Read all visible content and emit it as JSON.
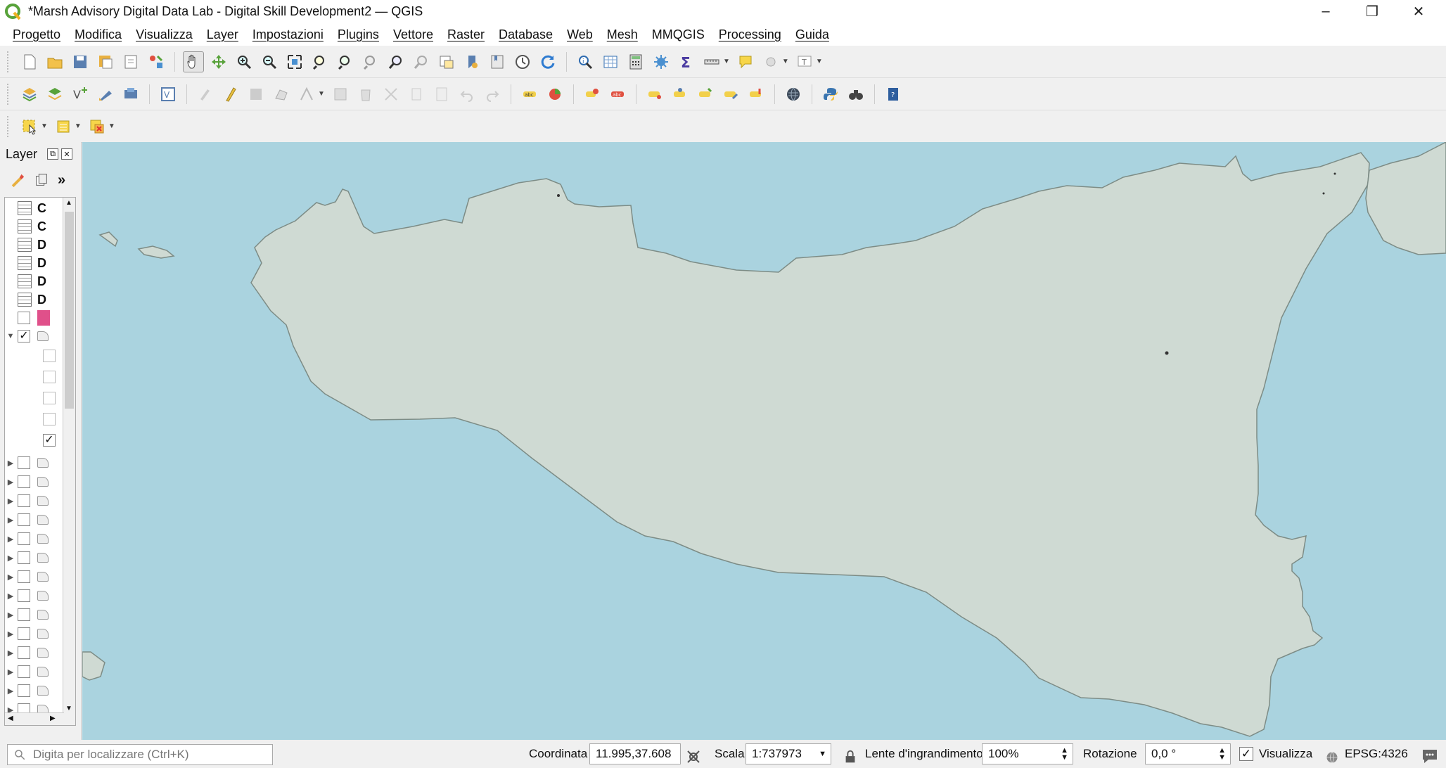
{
  "window": {
    "title": "*Marsh Advisory Digital Data Lab - Digital Skill Development2 — QGIS",
    "app_icon": "qgis-logo-icon"
  },
  "menu": [
    "Progetto",
    "Modifica",
    "Visualizza",
    "Layer",
    "Impostazioni",
    "Plugins",
    "Vettore",
    "Raster",
    "Database",
    "Web",
    "Mesh",
    "MMQGIS",
    "Processing",
    "Guida"
  ],
  "layer_panel": {
    "title": "Layer",
    "rows": [
      {
        "type": "table",
        "label": "C"
      },
      {
        "type": "table",
        "label": "C"
      },
      {
        "type": "table",
        "label": "D"
      },
      {
        "type": "table",
        "label": "D"
      },
      {
        "type": "table",
        "label": "D"
      },
      {
        "type": "table",
        "label": "D"
      }
    ]
  },
  "status": {
    "locator_placeholder": "Digita per localizzare (Ctrl+K)",
    "coord_label": "Coordinata",
    "coord_value": "11.995,37.608",
    "scale_label": "Scala",
    "scale_value": "1:737973",
    "magnifier_label": "Lente d'ingrandimento",
    "magnifier_value": "100%",
    "rotation_label": "Rotazione",
    "rotation_value": "0,0 °",
    "render_label": "Visualizza",
    "crs": "EPSG:4326"
  },
  "colors": {
    "sea": "#aad3df",
    "land": "#cfdad3",
    "coast": "#7d8c86",
    "swatch": "#e0508a"
  }
}
